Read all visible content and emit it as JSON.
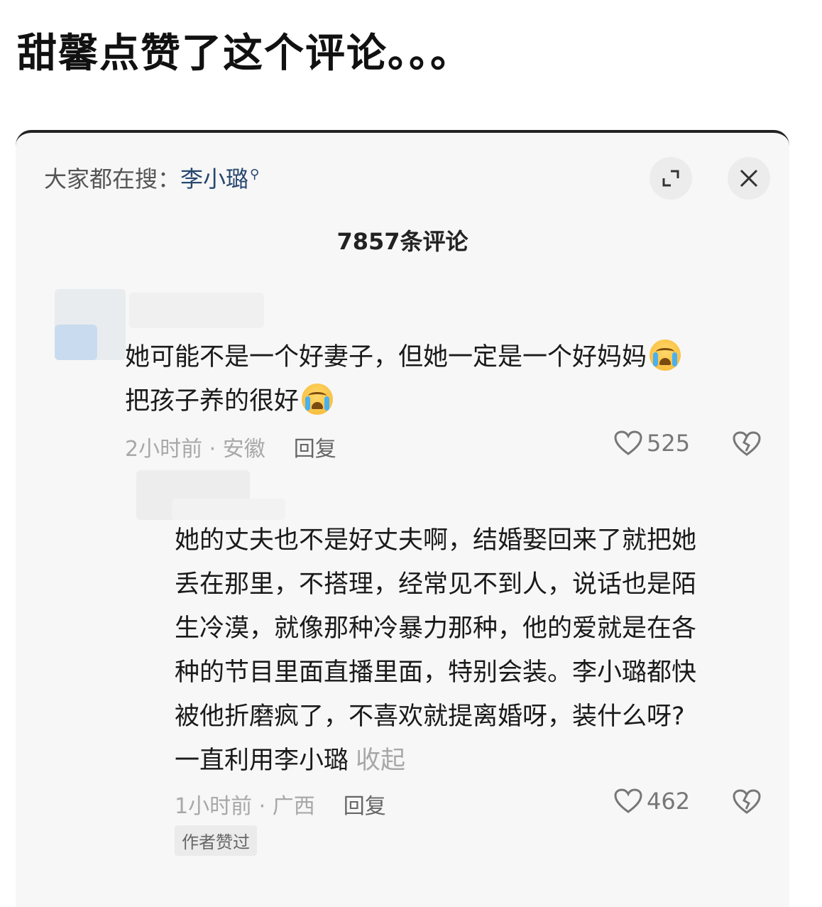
{
  "headline": "甜馨点赞了这个评论。。。",
  "search_bar": {
    "prefix": "大家都在搜：",
    "keyword": "李小璐"
  },
  "comment_count": "7857条评论",
  "comments": [
    {
      "lines": [
        "她可能不是一个好妻子，但她一定是一个好妈妈",
        "把孩子养的很好"
      ],
      "meta": "2小时前 · 安徽",
      "reply_label": "回复",
      "likes": "525"
    },
    {
      "lines": [
        "她的丈夫也不是好丈夫啊，结婚娶回来了就把她",
        "丢在那里，不搭理，经常见不到人，说话也是陌",
        "生冷漠，就像那种冷暴力那种，他的爱就是在各",
        "种的节目里面直播里面，特别会装。李小璐都快",
        "被他折磨疯了，不喜欢就提离婚呀，装什么呀?",
        "一直利用李小璐"
      ],
      "collapse_label": "收起",
      "meta": "1小时前 · 广西",
      "reply_label": "回复",
      "likes": "462",
      "badge": "作者赞过"
    }
  ],
  "icons": {
    "expand": "expand-icon",
    "close": "close-icon",
    "like": "heart-icon",
    "dislike": "broken-heart-icon",
    "emoji": "crying-face-emoji"
  }
}
